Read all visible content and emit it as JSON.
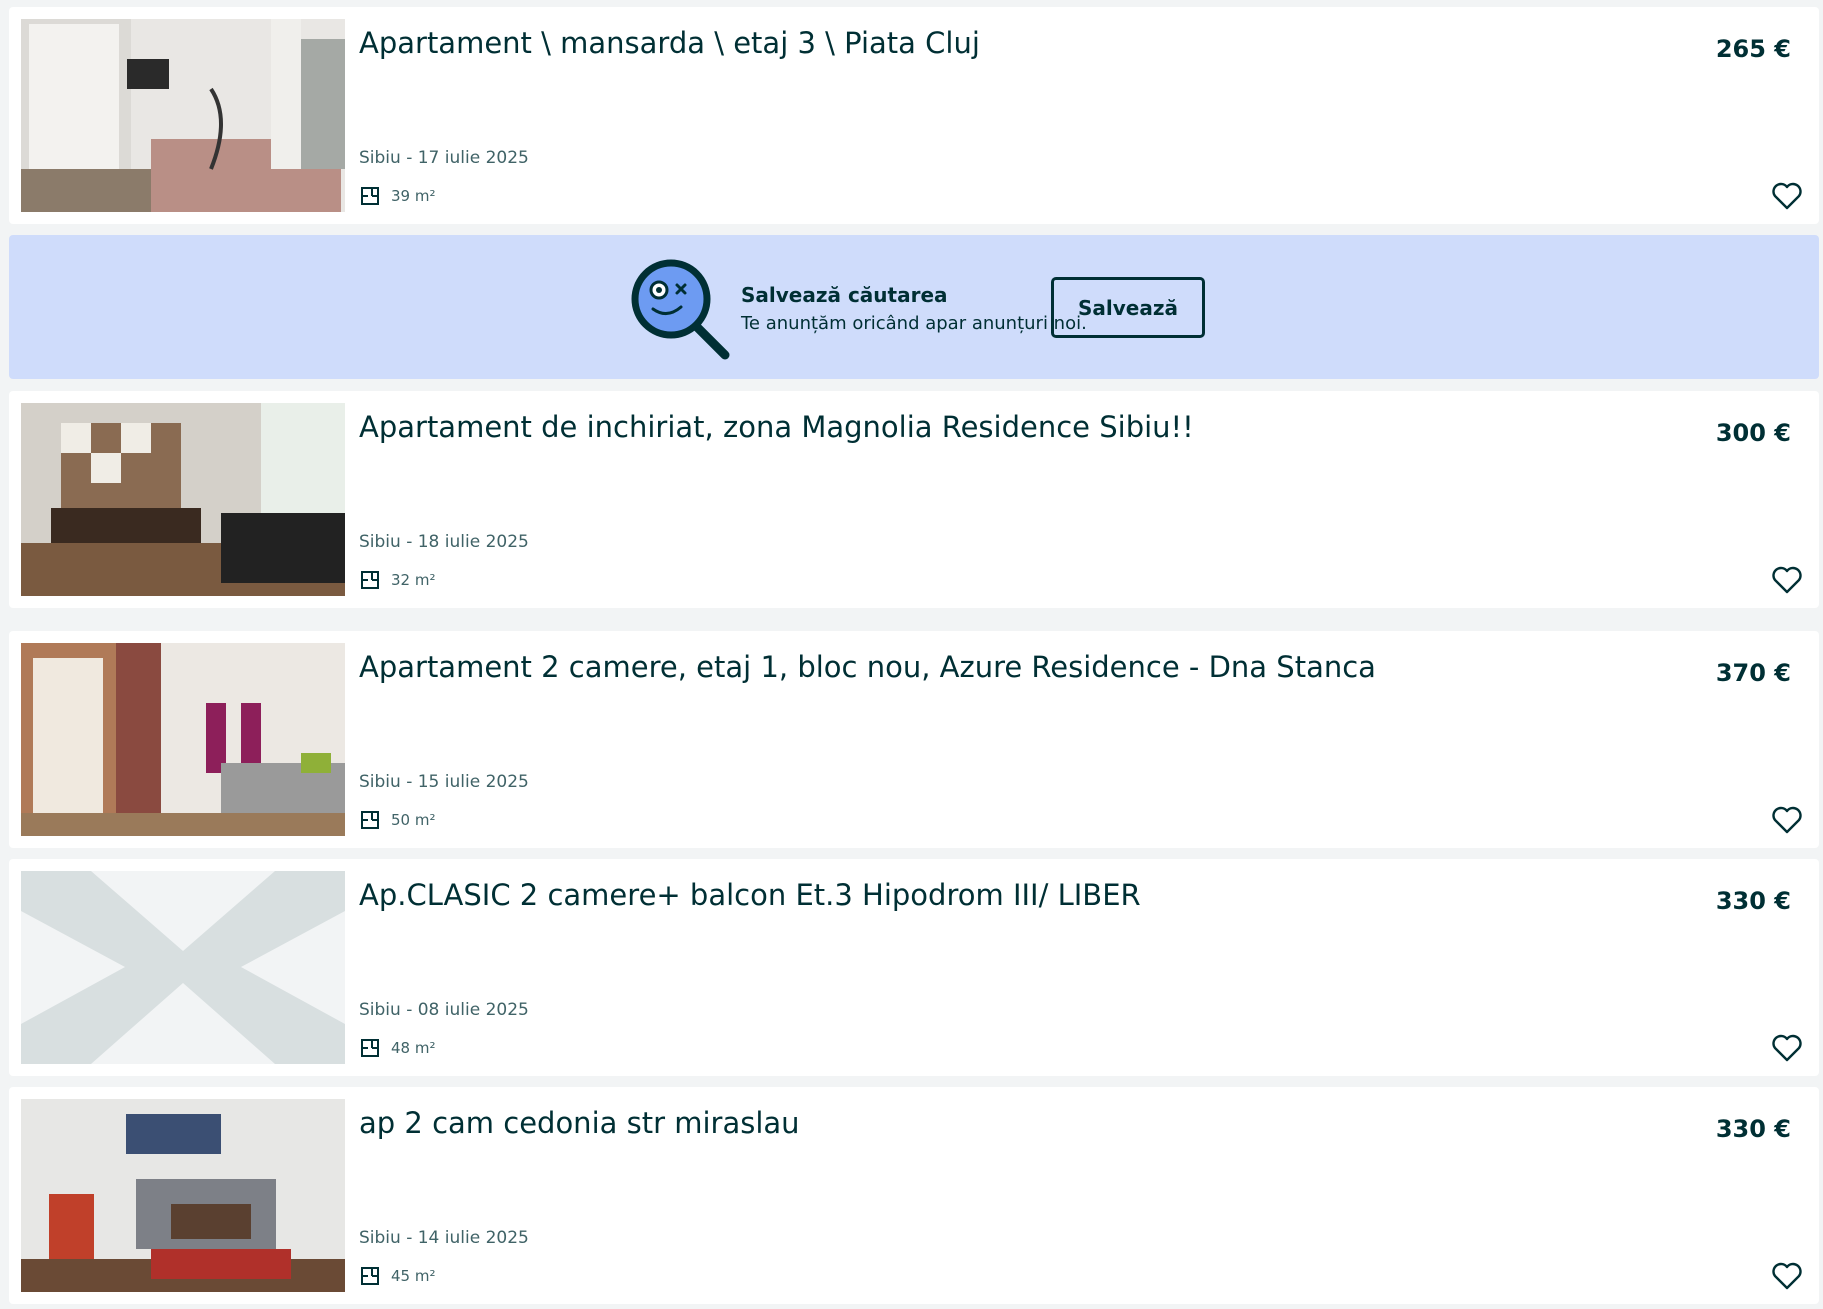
{
  "listings": [
    {
      "title": "Apartament \\ mansarda \\ etaj 3 \\ Piata Cluj",
      "price": "265 €",
      "location": "Sibiu - 17 iulie 2025",
      "area": "39 m²",
      "image": "bedroom-photo"
    },
    {
      "title": "Apartament de inchiriat, zona Magnolia Residence Sibiu!!",
      "price": "300 €",
      "location": "Sibiu - 18 iulie 2025",
      "area": "32 m²",
      "image": "kitchen-photo"
    },
    {
      "title": "Apartament 2 camere, etaj 1, bloc nou, Azure Residence - Dna Stanca",
      "price": "370 €",
      "location": "Sibiu - 15 iulie 2025",
      "area": "50 m²",
      "image": "living-room-photo"
    },
    {
      "title": "Ap.CLASIC 2 camere+ balcon Et.3 Hipodrom III/ LIBER",
      "price": "330 €",
      "location": "Sibiu - 08 iulie 2025",
      "area": "48 m²",
      "image": "no-image-placeholder"
    },
    {
      "title": "ap 2 cam cedonia str miraslau",
      "price": "330 €",
      "location": "Sibiu - 14 iulie 2025",
      "area": "45 m²",
      "image": "sofa-living-photo"
    }
  ],
  "save_search": {
    "title": "Salvează căutarea",
    "subtitle": "Te anunțăm oricând apar anunțuri noi.",
    "button": "Salvează"
  },
  "colors": {
    "text": "#002f34",
    "muted": "#406367",
    "banner_bg": "#cfdcfb",
    "page_bg": "#f2f4f5"
  }
}
